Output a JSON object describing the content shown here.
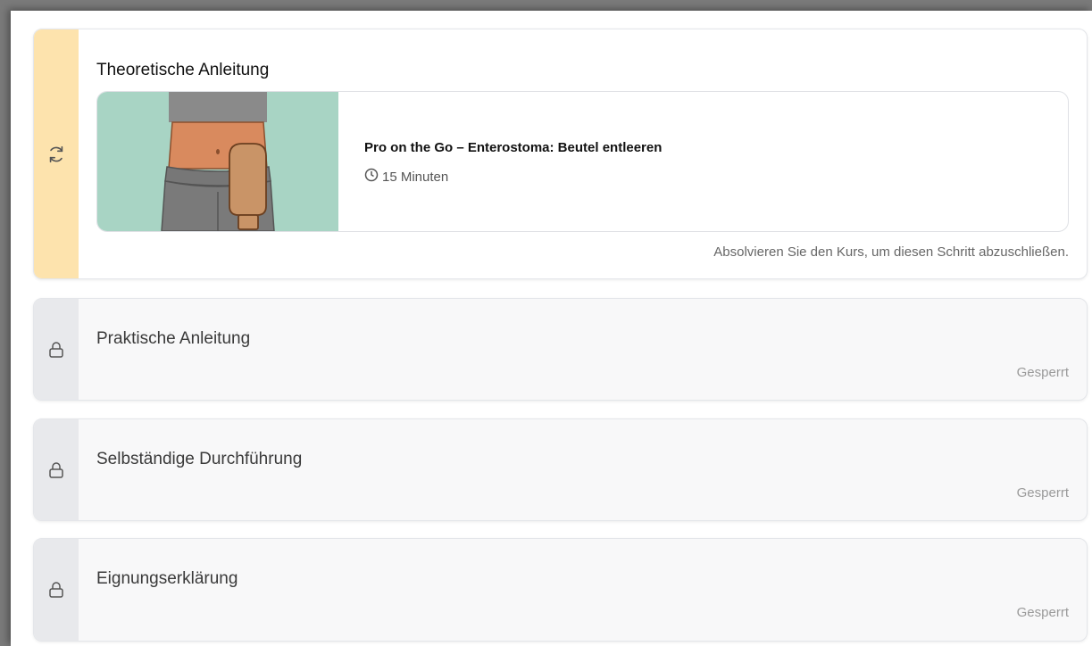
{
  "steps": [
    {
      "title": "Theoretische Anleitung",
      "state": "in-progress",
      "status_icon": "refresh-icon",
      "course": {
        "title": "Pro on the Go – Enterostoma: Beutel entleeren",
        "duration": "15 Minuten",
        "duration_icon": "clock-icon",
        "thumbnail": "ostomy-bag-illustration"
      },
      "hint": "Absolvieren Sie den Kurs, um diesen Schritt abzuschließen."
    },
    {
      "title": "Praktische Anleitung",
      "state": "locked",
      "status_icon": "lock-icon",
      "status": "Gesperrt"
    },
    {
      "title": "Selbständige Durchführung",
      "state": "locked",
      "status_icon": "lock-icon",
      "status": "Gesperrt"
    },
    {
      "title": "Eignungserklärung",
      "state": "locked",
      "status_icon": "lock-icon",
      "status": "Gesperrt"
    }
  ],
  "colors": {
    "active_rail": "#fde3ad",
    "locked_rail": "#e8e9ec",
    "thumbnail_bg": "#a8d4c4"
  }
}
